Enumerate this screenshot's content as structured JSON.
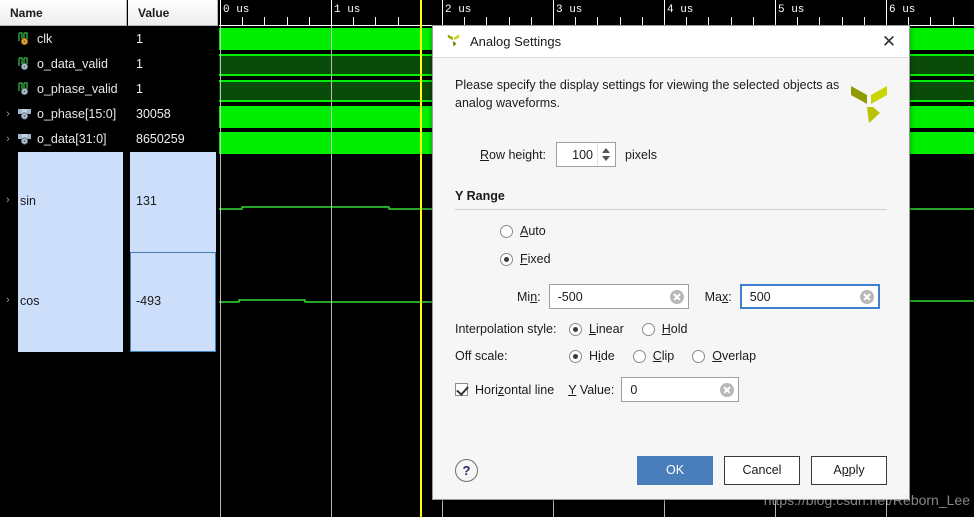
{
  "panel": {
    "headers": {
      "name": "Name",
      "value": "Value"
    },
    "signals": [
      {
        "label": "clk",
        "value": "1",
        "icon": "clock-signal-icon",
        "expandable": false,
        "icon_kind": "wave-orange"
      },
      {
        "label": "o_data_valid",
        "value": "1",
        "icon": "wave-signal-icon",
        "expandable": false,
        "icon_kind": "wave-gray"
      },
      {
        "label": "o_phase_valid",
        "value": "1",
        "icon": "wave-signal-icon",
        "expandable": false,
        "icon_kind": "wave-gray"
      },
      {
        "label": "o_phase[15:0]",
        "value": "30058",
        "icon": "bus-signal-icon",
        "expandable": true,
        "icon_kind": "bus"
      },
      {
        "label": "o_data[31:0]",
        "value": "8650259",
        "icon": "bus-signal-icon",
        "expandable": true,
        "icon_kind": "bus"
      }
    ],
    "analog_signals": [
      {
        "label": "sin",
        "value": "131",
        "selected": true,
        "focused": false
      },
      {
        "label": "cos",
        "value": "-493",
        "selected": true,
        "focused": true
      }
    ],
    "expand_arrow": "›"
  },
  "ruler": {
    "labels": [
      "0 us",
      "1 us",
      "2 us",
      "3 us",
      "4 us",
      "5 us",
      "6 us"
    ],
    "cursor_time": "2 us",
    "cursor_color": "#ffff00"
  },
  "waveform": {
    "high_color": "#00ef00",
    "bus_color": "#0a4b0a",
    "background": "#000000",
    "trace_color": "#33dd33"
  },
  "dialog": {
    "title": "Analog Settings",
    "close_icon": "✕",
    "logo_icon": "xilinx-logo-icon",
    "intro": "Please specify the display settings for viewing the selected objects as analog waveforms.",
    "row_height": {
      "label": "Row height:",
      "label_prefix": "R",
      "label_rest": "ow height:",
      "value": "100",
      "unit": "pixels"
    },
    "y_range": {
      "title": "Y Range",
      "options": [
        {
          "label": "Auto",
          "prefix": "A",
          "rest": "uto",
          "selected": false
        },
        {
          "label": "Fixed",
          "prefix": "F",
          "rest": "ixed",
          "selected": true
        }
      ],
      "min": {
        "label": "Min:",
        "value": "-500",
        "focused": false
      },
      "max": {
        "label": "Max:",
        "value": "500",
        "focused": true
      }
    },
    "interpolation": {
      "caption": "Interpolation style:",
      "options": [
        {
          "label": "Linear",
          "prefix": "L",
          "rest": "inear",
          "selected": true
        },
        {
          "label": "Hold",
          "prefix": "H",
          "rest": "old",
          "selected": false
        }
      ]
    },
    "off_scale": {
      "caption": "Off scale:",
      "options": [
        {
          "label": "Hide",
          "prefix": "H",
          "mid": "i",
          "rest": "de",
          "selected": true
        },
        {
          "label": "Clip",
          "prefix": "C",
          "mid": "",
          "rest": "lip",
          "selected": false
        },
        {
          "label": "Overlap",
          "prefix": "O",
          "mid": "",
          "rest": "verlap",
          "selected": false
        }
      ]
    },
    "horizontal_line": {
      "label": "Horizontal line",
      "checked": true,
      "y_value_label": "Y Value:",
      "y_value": "0"
    },
    "buttons": {
      "help": "?",
      "ok": "OK",
      "cancel": "Cancel",
      "apply": "Apply"
    }
  },
  "watermark": "https://blog.csdn.net/Reborn_Lee"
}
